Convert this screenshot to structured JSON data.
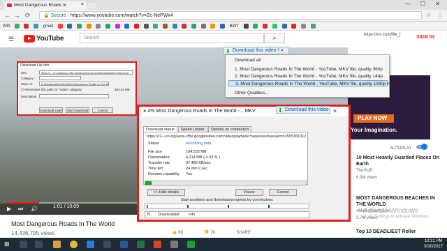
{
  "browser": {
    "tab_title": "Most Dangerous Roads In",
    "close": "×",
    "back": "←",
    "forward": "→",
    "reload": "⟳",
    "secure_label": "Secure",
    "url": "https://www.youtube.com/watch?v=Zc-NePWx4",
    "window_controls": "— ☐ ✕"
  },
  "bookmarks": [
    "Wifi",
    "gmail",
    "BWT"
  ],
  "youtube": {
    "logo_text": "YouTube",
    "search_placeholder": "Search",
    "search_icon": "search-icon",
    "signin": "SIGN IN",
    "url_right": "https://ws.com/file_t"
  },
  "video": {
    "title": "Most Dangerous Roads In The World",
    "views": "14,436,795 views",
    "time": "1:01 / 10:09",
    "progress_fraction": 0.1,
    "likes": "6K",
    "dislikes": "7K",
    "share": "SHARE"
  },
  "idm_small": {
    "title": "Download File Info",
    "url_label": "URL",
    "url_value": "https://r---sn-cjq2wos-cf5e.googlevideo.com/videoplayback?requiressl=",
    "category_label": "Category",
    "saveas_label": "Save As",
    "saveas_value": "D:\\Downloads\\Video\\Most Dangerous Roads In The World - YouTube_M",
    "size": "104.52 MB",
    "remember_label": "Remember this path for \"Video\" category",
    "desc_label": "Description",
    "btn_later": "Download Later",
    "btn_start": "Start Download",
    "btn_cancel": "Cancel"
  },
  "dl_menu": {
    "button_label": "Download this video",
    "items": [
      "Download all",
      "1.  Most Dangerous Roads In The World - YouTube,  MKV file, quality 360p",
      "2.  Most Dangerous Roads In The World - YouTube,  MKV file, quality 144p",
      "3.  Most Dangerous Roads In The World - YouTube,  MKV file, quality 1080p HD",
      "Other Qualities..."
    ]
  },
  "idm_big": {
    "title": "4% Most Dangerous Roads In The World - ...MKV",
    "tabs": [
      "Download status",
      "Speed Limiter",
      "Options on completion"
    ],
    "url": "https://r2---sn-cjq2wos-cf5e.googlevideo.com/videoplayback?requiressl=yes&mt=1505361012&ff",
    "status_k": "Status",
    "status_v": "Receiving data...",
    "size_k": "File size",
    "size_v": "104.532  MB",
    "down_k": "Downloaded",
    "down_v": "4.214  MB  ( 4.03 % )",
    "rate_k": "Transfer rate",
    "rate_v": "97.485  KB/sec",
    "left_k": "Time left",
    "left_v": "24 min 9 sec",
    "resume_k": "Resume capability",
    "resume_v": "Yes",
    "progress_fraction": 0.0403,
    "btn_hide": "<< Hide details",
    "btn_pause": "Pause",
    "btn_cancel": "Cancel",
    "conn_label": "Start positions and download progress by connections",
    "col_n": "N.",
    "col_down": "Downloaded",
    "col_info": "Info"
  },
  "sidebar": {
    "ad_button": "PLAY NOW",
    "ad_tagline": "Your Imagination.",
    "autoplay": "AUTOPLAY",
    "related": [
      {
        "title": "10 Most Heavily Guarded Places On Earth",
        "channel": "TheHUB",
        "views": "6.3M views"
      },
      {
        "title": "MOST DANGEROUS BEACHES IN THE WORLD",
        "channel": "#Mind Warehouse",
        "views": "3.7M views"
      },
      {
        "title": "Top 10 DEADLIEST Roller",
        "channel": "",
        "views": ""
      }
    ]
  },
  "watermark": [
    "Activate Windows",
    "Go to Settings to activate Windows."
  ],
  "taskbar": {
    "time": "12:21 PM",
    "date": "9/30/2017"
  }
}
